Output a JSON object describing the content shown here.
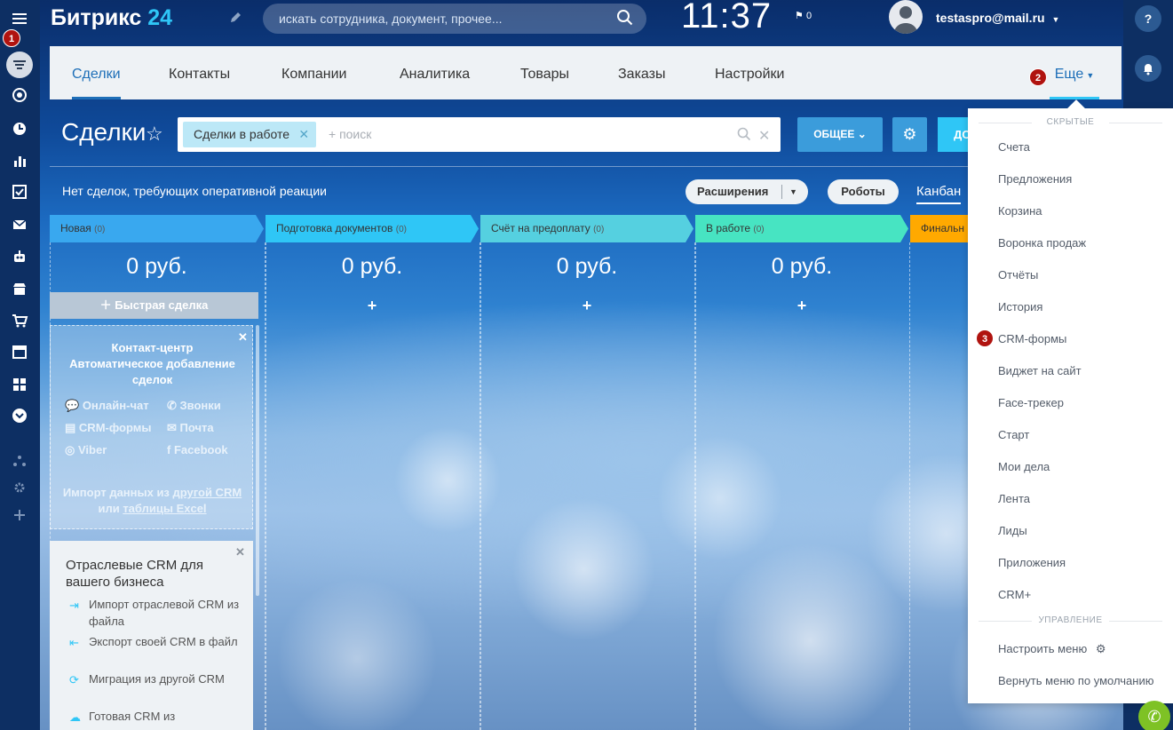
{
  "colors": {
    "accent": "#1e6fb8",
    "brand_light": "#2fc6f6",
    "sidebar": "#0d2f63",
    "badge": "#b0130f"
  },
  "header": {
    "logo_main": "Битрикс",
    "logo_num": "24",
    "search_placeholder": "искать сотрудника, документ, прочее...",
    "time": "11:37",
    "flag_count": "0",
    "user": "testaspro@mail.ru"
  },
  "badges": {
    "one": "1",
    "two": "2",
    "three": "3"
  },
  "tabs": [
    {
      "label": "Сделки"
    },
    {
      "label": "Контакты"
    },
    {
      "label": "Компании"
    },
    {
      "label": "Аналитика"
    },
    {
      "label": "Товары"
    },
    {
      "label": "Заказы"
    },
    {
      "label": "Настройки"
    }
  ],
  "more_label": "Еще",
  "page": {
    "title": "Сделки",
    "filter_chip": "Сделки в работе",
    "filter_placeholder": "+ поиск",
    "common_button": "ОБЩЕЕ",
    "add_button": "ДО",
    "notice": "Нет сделок, требующих оперативной реакции",
    "ext_button": "Расширения",
    "robots_button": "Роботы",
    "kanban_label": "Канбан"
  },
  "stages": [
    {
      "name": "Новая",
      "count": "(0)",
      "sum": "0 руб.",
      "color": "#39a8ef"
    },
    {
      "name": "Подготовка документов",
      "count": "(0)",
      "sum": "0 руб.",
      "color": "#2fc6f6"
    },
    {
      "name": "Счёт на предоплату",
      "count": "(0)",
      "sum": "0 руб.",
      "color": "#55d0e0"
    },
    {
      "name": "В работе",
      "count": "(0)",
      "sum": "0 руб.",
      "color": "#47e4c2"
    },
    {
      "name": "Финальн",
      "count": "",
      "sum": "",
      "color": "#ffa900"
    }
  ],
  "quick_deal": "Быстрая сделка",
  "contact_center": {
    "title_line1": "Контакт-центр",
    "title_line2": "Автоматическое добавление",
    "title_line3": "сделок",
    "items": [
      "Онлайн-чат",
      "Звонки",
      "CRM-формы",
      "Почта",
      "Viber",
      "Facebook"
    ],
    "import_pre": "Импорт данных из ",
    "import_link1": "другой CRM",
    "import_mid": "или ",
    "import_link2": "таблицы Excel"
  },
  "industry": {
    "title": "Отраслевые CRM для вашего бизнеса",
    "items": [
      "Импорт отраслевой CRM из файла",
      "Экспорт своей CRM в файл",
      "Миграция из другой CRM",
      "Готовая CRM из"
    ]
  },
  "menu": {
    "section_hidden": "СКРЫТЫЕ",
    "items": [
      "Счета",
      "Предложения",
      "Корзина",
      "Воронка продаж",
      "Отчёты",
      "История",
      "CRM-формы",
      "Виджет на сайт",
      "Face-трекер",
      "Старт",
      "Мои дела",
      "Лента",
      "Лиды",
      "Приложения",
      "CRM+"
    ],
    "section_manage": "УПРАВЛЕНИЕ",
    "configure": "Настроить меню",
    "reset": "Вернуть меню по умолчанию"
  }
}
